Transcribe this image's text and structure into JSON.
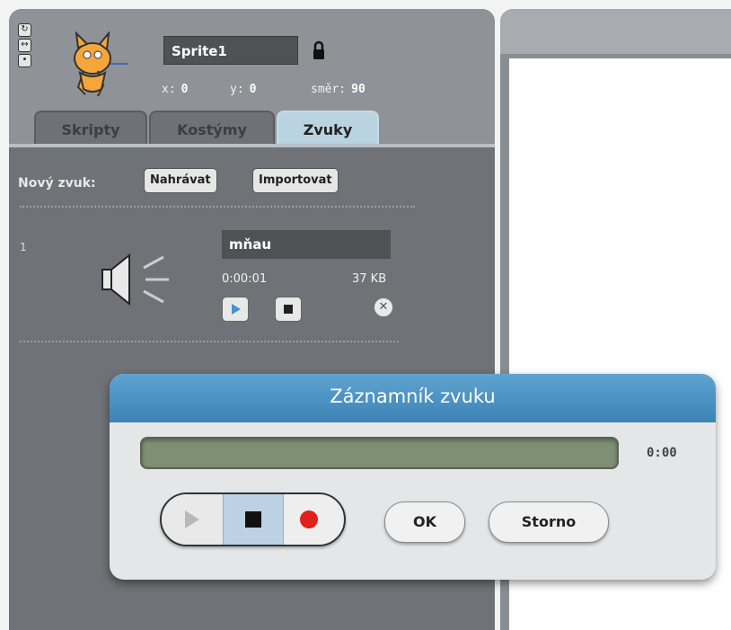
{
  "sprite": {
    "name": "Sprite1",
    "x_label": "x:",
    "x_value": "0",
    "y_label": "y:",
    "y_value": "0",
    "direction_label": "směr:",
    "direction_value": "90"
  },
  "tabs": [
    {
      "label": "Skripty",
      "active": false
    },
    {
      "label": "Kostýmy",
      "active": false
    },
    {
      "label": "Zvuky",
      "active": true
    }
  ],
  "sounds_pane": {
    "new_sound_label": "Nový zvuk:",
    "record_button": "Nahrávat",
    "import_button": "Importovat",
    "items": [
      {
        "index": "1",
        "name": "mňau",
        "duration": "0:00:01",
        "size": "37 KB"
      }
    ]
  },
  "recorder_dialog": {
    "title": "Záznamník zvuku",
    "time": "0:00",
    "progress": 0.0,
    "ok_button": "OK",
    "cancel_button": "Storno"
  },
  "colors": {
    "dialog_title_bg": "#4a90c4",
    "record_dot": "#e0201c",
    "active_tab_bg": "#b9d3e0"
  },
  "icons": [
    "rotate-icon",
    "left-right-icon",
    "no-rotate-icon",
    "cat-sprite-icon",
    "lock-icon",
    "speaker-icon",
    "play-icon",
    "stop-icon",
    "delete-icon",
    "record-icon"
  ]
}
